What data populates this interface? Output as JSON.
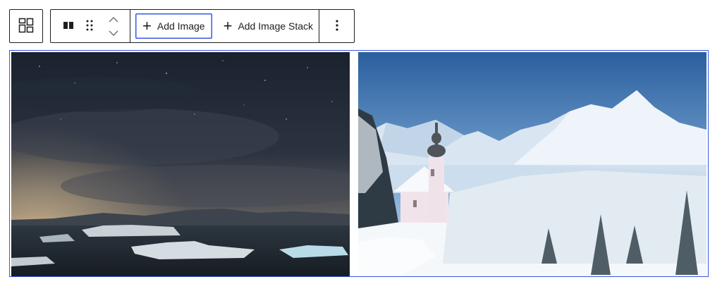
{
  "toolbar": {
    "parent_icon": "grid-layout-icon",
    "block_icon": "gallery-columns-icon",
    "drag_icon": "drag-handle-icon",
    "move_up_icon": "chevron-up-icon",
    "move_down_icon": "chevron-down-icon",
    "add_image_label": "Add Image",
    "add_image_stack_label": "Add Image Stack",
    "more_icon": "more-vertical-icon"
  },
  "gallery": {
    "images": [
      {
        "subject": "night sky over icebergs and lake"
      },
      {
        "subject": "snowy chapel with onion dome in alpine mountains"
      }
    ]
  },
  "colors": {
    "accent": "#3858e9",
    "toolbar_border": "#1e1e1e"
  }
}
